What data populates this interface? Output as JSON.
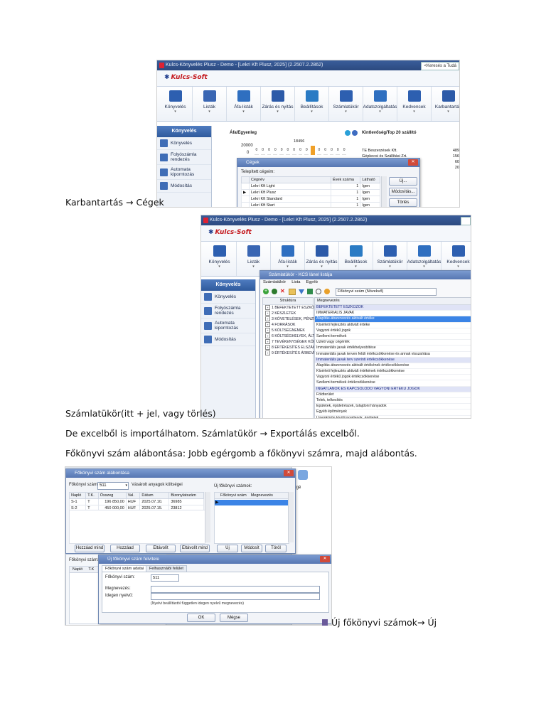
{
  "doc": {
    "line1": "Karbantartás → Cégek",
    "line2": "Számlatükör(itt + jel, vagy törlés)",
    "line3": "De excelből is importálhatom. Számlatükör → Exportálás excelből.",
    "line4": "Főkönyvi szám alábontása: Jobb egérgomb a főkönyvi számra, majd alábontás.",
    "line5": "Új főkönyvi számok→ Új"
  },
  "app": {
    "title": "Kulcs-Könyvelés Plusz - Demo - [Lekri Kft Plusz, 2025] (2.2507.2.2862)",
    "logo": "Kulcs-Soft",
    "search_placeholder": "<Keresés a Tudá",
    "ribbon": [
      "Könyvelés",
      "Listák",
      "Áfa-listák",
      "Zárás és nyitás",
      "Beállítások",
      "Számlatükör",
      "Adatszolgáltatás",
      "Kedvencek",
      "Karbantartás"
    ],
    "sidebar_header": "Könyvelés",
    "sidebar": [
      "Könyvelés",
      "Folyószámla rendezés",
      "Automata kiporntozás",
      "Módosítás"
    ]
  },
  "shot1": {
    "widget_afa_title": "Áfa/Egyenleg",
    "widget_afa_axis": "20000",
    "widget_afa_zero": "0",
    "widget_afa_peak": "18496",
    "bar_values": [
      0,
      0,
      0,
      0,
      0,
      0,
      0,
      0,
      0,
      18496,
      0,
      0,
      0,
      0,
      0
    ],
    "widget_top_title": "Kintlevőség/Top 20 szállító",
    "top_rows": [
      {
        "name": "TE Beszerzések Kft.",
        "value": "489"
      },
      {
        "name": "Gépkocsi és Szállítási Zrt.",
        "value": "156"
      },
      {
        "name": "",
        "value": "60"
      },
      {
        "name": "",
        "value": "20"
      }
    ],
    "dialog": {
      "title": "Cégek",
      "subtitle": "Telepített cégeim:",
      "columns": [
        "Cégnév",
        "Évek száma",
        "Látható"
      ],
      "rows": [
        {
          "name": "Lekri Kft Light",
          "years": "1",
          "visible": "Igen"
        },
        {
          "name": "Lekri Kft Plusz",
          "years": "1",
          "visible": "Igen"
        },
        {
          "name": "Lekri Kft Standard",
          "years": "1",
          "visible": "Igen"
        },
        {
          "name": "Lekri Kft Start",
          "years": "1",
          "visible": "Igen"
        }
      ],
      "buttons": [
        "Új...",
        "Módosítás...",
        "Törlés"
      ]
    }
  },
  "shot2": {
    "dialog": {
      "title": "Számlatükör - KCS lánel listája",
      "menu": [
        "Számlatükör",
        "Lista",
        "Egyéb"
      ],
      "sort_select": "Főkönyvi szám (Növekvő)",
      "tree_header": "Struktúra",
      "tree": [
        "1 BEFEKTETETT ESZKÖZÖK",
        "2 KÉSZLETEK",
        "3 KÖVETELÉSEK, PÉNZÜGYI",
        "4 FORRÁSOK",
        "5 KÖLTSÉGNEMEK",
        "6 KÖLTSÉGHELYEK, ÁLTALÁNOS",
        "7 TEVÉKENYSÉGEK KÖLTSÉGEI",
        "8 ÉRTÉKESÍTÉS ELSZÁMOLT",
        "9 ÉRTÉKESÍTÉS ÁRBEVÉTELE"
      ],
      "list_header": "Megnevezés",
      "accounts": [
        {
          "text": "BEFEKTETETT ESZKÖZÖK",
          "style": "group"
        },
        {
          "text": "IMMATERIÁLIS JAVAK",
          "style": "plain"
        },
        {
          "text": "Alapítás-átszervezés aktivált értéke",
          "style": "selected"
        },
        {
          "text": "Kísérleti fejlesztés aktivált értéke",
          "style": "plain"
        },
        {
          "text": "Vagyoni értékű jogok",
          "style": "plain"
        },
        {
          "text": "Szellemi termékek",
          "style": "plain"
        },
        {
          "text": "Üzleti vagy cégérték",
          "style": "plain"
        },
        {
          "text": "Immateriális javak értékhelyesbítése",
          "style": "plain"
        },
        {
          "text": "Immateriális javak terven felüli értékcsökkenése és annak visszaírása",
          "style": "plain"
        },
        {
          "text": "Immateriális javak terv szerinti értékcsökkenése",
          "style": "group"
        },
        {
          "text": "Alapítás-átszervezés aktivált értékének értékcsökkenése",
          "style": "plain"
        },
        {
          "text": "Kísérleti fejlesztés aktivált értékének értékcsökkenése",
          "style": "plain"
        },
        {
          "text": "Vagyoni értékű jogok értékcsökkenése",
          "style": "plain"
        },
        {
          "text": "Szellemi termékek értékcsökkenése",
          "style": "plain"
        },
        {
          "text": "INGATLANOK ÉS KAPCSOLÓDÓ VAGYONI ÉRTÉKŰ JOGOK",
          "style": "group"
        },
        {
          "text": "Földterület",
          "style": "plain"
        },
        {
          "text": "Telek, telkesítés",
          "style": "plain"
        },
        {
          "text": "Épületek, épületrészek, tulajdoni hányadok",
          "style": "plain"
        },
        {
          "text": "Egyéb építmények",
          "style": "plain"
        },
        {
          "text": "Üzemkörön kívüli ingatlanok, épületek",
          "style": "plain"
        },
        {
          "text": "Ingatlanokhoz kapcsolódó vagyoni értékű jogok",
          "style": "plain"
        }
      ]
    }
  },
  "shot3": {
    "dialog_title": "Főkönyvi szám alábontása",
    "account_label": "Főkönyvi szám:",
    "account_value": "511",
    "account_desc": "Vásárolt anyagok költségei",
    "columns": [
      "Napló",
      "T.K.",
      "Összeg",
      "Val.",
      "Dátum",
      "Bizonylatszám"
    ],
    "rows": [
      {
        "naplo": "S-1",
        "tk": "T",
        "amount": "196 850,00",
        "cur": "HUF",
        "date": "2025.07.10.",
        "doc": "36985"
      },
      {
        "naplo": "S-2",
        "tk": "T",
        "amount": "450 000,00",
        "cur": "HUF",
        "date": "2025.07.15.",
        "doc": "23812"
      }
    ],
    "new_accounts_title": "Új főkönyvi számok:",
    "new_columns": [
      "Főkönyvi szám",
      "Megnevezés"
    ],
    "left_buttons": [
      "Hozzáad mind",
      "Hozzáad",
      "Eltávolít",
      "Eltávolít mind"
    ],
    "right_buttons": [
      "Új",
      "Módosít",
      "Töröl"
    ],
    "lower_label": "Főkönyvi szám:",
    "lower_columns": [
      "Napló",
      "T.K"
    ],
    "side_label": "Igé",
    "sub_dialog": {
      "title": "Új főkönyvi szám felvitele",
      "tabs": [
        "Főkönyvi szám adatai",
        "Felhasználói felület"
      ],
      "field_account_label": "Főkönyvi szám:",
      "field_account_value": "511",
      "field_name_label": "Megnevezés:",
      "field_foreign_label": "Idegen nyelvű:",
      "hint": "(Nyelvi beállítástól független idegen nyelvű megnevezés)",
      "ok": "OK",
      "cancel": "Mégse"
    }
  },
  "colors": {
    "accent": "#2f5a9c",
    "selection": "#3b84e6",
    "group_bg": "#dfe3f6",
    "logo_red": "#c41a1f"
  }
}
